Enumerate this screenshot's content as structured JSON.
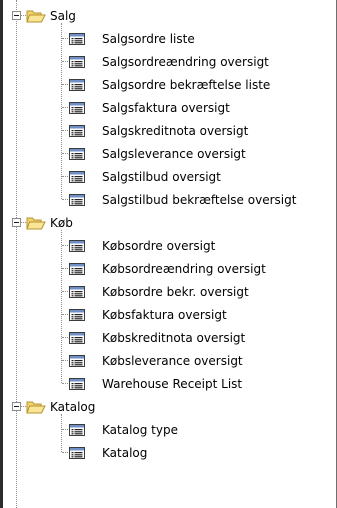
{
  "tree": {
    "groups": [
      {
        "label": "Salg",
        "items": [
          "Salgsordre liste",
          "Salgsordreændring oversigt",
          "Salgsordre bekræftelse liste",
          "Salgsfaktura oversigt",
          "Salgskreditnota oversigt",
          "Salgsleverance oversigt",
          "Salgstilbud oversigt",
          "Salgstilbud bekræftelse oversigt"
        ]
      },
      {
        "label": "Køb",
        "items": [
          "Købsordre oversigt",
          "Købsordreændring oversigt",
          "Købsordre bekr. oversigt",
          "Købsfaktura oversigt",
          "Købskreditnota oversigt",
          "Købsleverance oversigt",
          "Warehouse Receipt List"
        ]
      },
      {
        "label": "Katalog",
        "items": [
          "Katalog type",
          "Katalog"
        ]
      }
    ]
  },
  "icons": {
    "group_icon": "open-folder-icon",
    "item_icon": "report-list-icon",
    "expander_icon": "collapse-minus-icon"
  },
  "colors": {
    "folder_fill": "#f3d36b",
    "folder_edge": "#b8912e",
    "icon_border": "#3b3b3b",
    "icon_header": "#6f8fc7",
    "connector": "#8e8e8e"
  }
}
